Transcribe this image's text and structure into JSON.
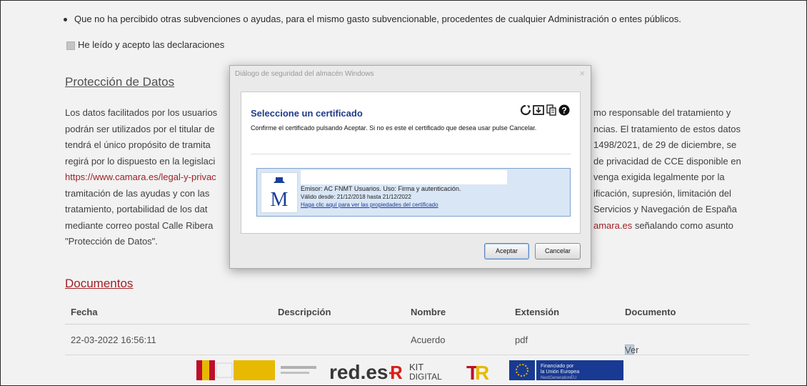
{
  "page": {
    "bullet_text": "Que no ha percibido otras subvenciones o ayudas, para el mismo gasto subvencionable, procedentes de cualquier Administración o entes públicos.",
    "accept_label": "He leído y acepto las declaraciones",
    "section_title": "Protección de Datos",
    "paragraph": {
      "left_lines": [
        "Los datos facilitados por los usuarios",
        "podrán ser utilizados por el titular de",
        "tendrá el único propósito de tramita",
        "regirá por lo dispuesto en la legislaci",
        "https://www.camara.es/legal-y-privac",
        "tramitación de las ayudas y con las",
        "tratamiento, portabilidad de los dat",
        "mediante correo postal Calle Ribera",
        "\"Protección de Datos\"."
      ],
      "right_lines": [
        "mo responsable del tratamiento y",
        "ncias. El tratamiento de estos datos",
        "1498/2021, de 29 de diciembre, se",
        "de privacidad de CCE disponible en",
        "venga exigida legalmente por la",
        "ificación, supresión, limitación del",
        "Servicios y Navegación de España",
        "amara.es señalando como asunto",
        ""
      ]
    },
    "documents_title": "Documentos",
    "table": {
      "headers": [
        "Fecha",
        "Descripción",
        "Nombre",
        "Extensión",
        "Documento"
      ],
      "rows": [
        {
          "fecha": "22-03-2022 16:56:11",
          "descripcion": "",
          "nombre": "Acuerdo",
          "extension": "pdf",
          "documento": "Ver"
        }
      ]
    },
    "footer_logos": {
      "redes": "red.es",
      "kit_line1": "KIT",
      "kit_line2": "DIGITAL",
      "eu_line1": "Financiado por",
      "eu_line2": "la Unión Europea",
      "eu_line3": "NextGenerationEU"
    }
  },
  "dialog": {
    "window_title": "Diálogo de seguridad del almacén Windows",
    "close_glyph": "×",
    "heading": "Seleccione un certificado",
    "message": "Confirme el certificado pulsando Aceptar. Si no es este el certificado que desea usar pulse Cancelar.",
    "certificate": {
      "issuer": "Emisor: AC FNMT Usuarios. Uso: Firma y autenticación.",
      "validity": "Válido desde: 21/12/2018 hasta 21/12/2022",
      "details_link": "Haga clic aquí para ver las propiedades del certificado"
    },
    "accept_button": "Aceptar",
    "cancel_button": "Cancelar",
    "icons": [
      "refresh-icon",
      "import-icon",
      "certificate-store-icon",
      "help-icon"
    ]
  },
  "colors": {
    "accent_red": "#a8242a",
    "dialog_heading": "#1f3a8a",
    "cert_selected_bg": "#d9e6f5"
  }
}
